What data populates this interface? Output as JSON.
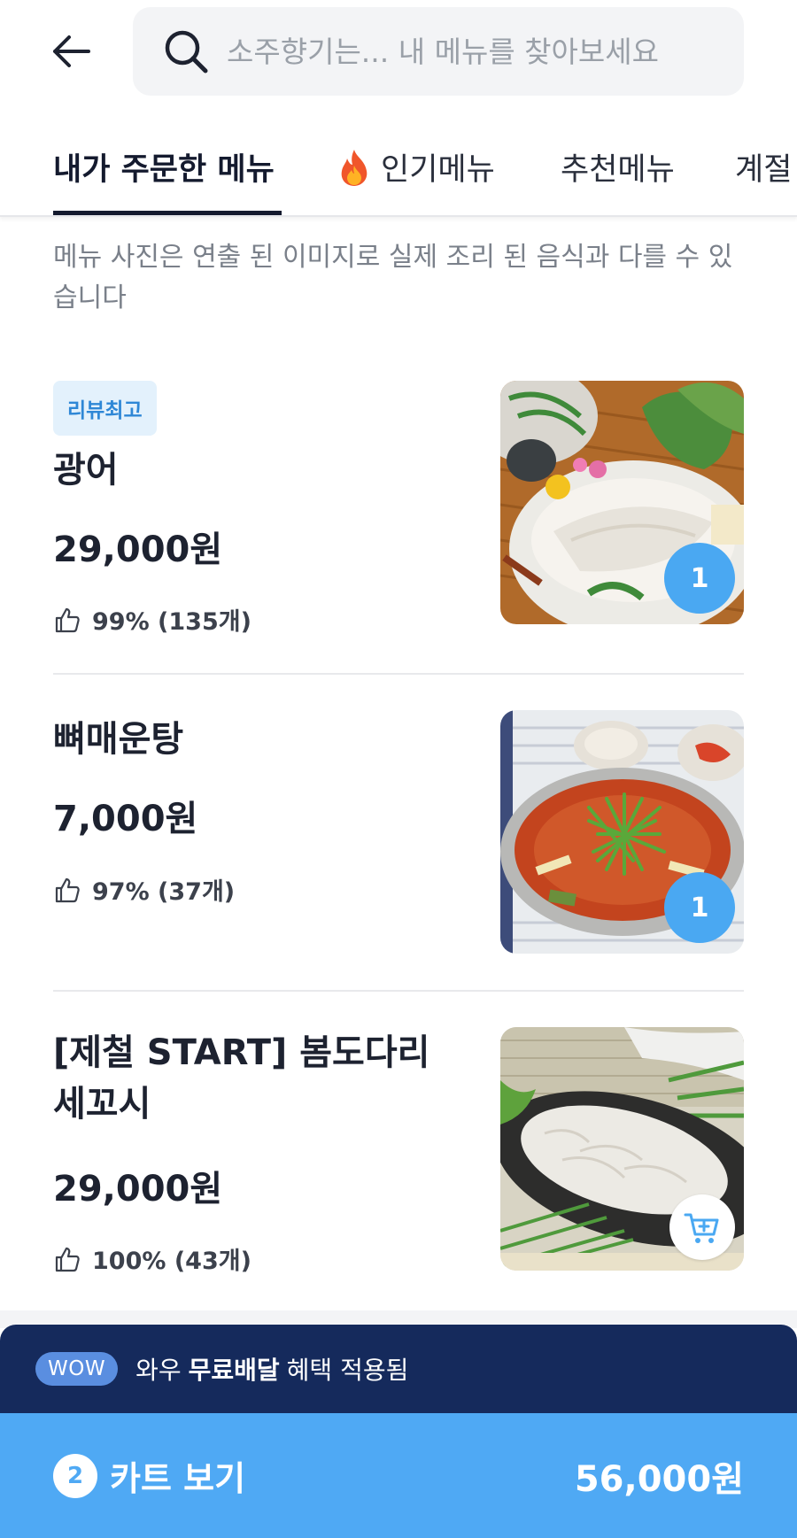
{
  "search": {
    "placeholder": "소주향기는... 내 메뉴를 찾아보세요"
  },
  "tabs": [
    {
      "label": "내가 주문한 메뉴",
      "active": true
    },
    {
      "label": "인기메뉴",
      "icon": "fire-icon"
    },
    {
      "label": "추천메뉴"
    },
    {
      "label": "계절"
    }
  ],
  "notice": "메뉴 사진은 연출 된 이미지로 실제 조리 된 음식과 다를 수 있습니다",
  "menu": [
    {
      "badge": "리뷰최고",
      "name": "광어",
      "price": "29,000원",
      "rating": "99% (135개)",
      "cart_qty": "1"
    },
    {
      "name": "뼈매운탕",
      "price": "7,000원",
      "rating": "97% (37개)",
      "cart_qty": "1"
    },
    {
      "name": "[제철 START] 봄도다리 세꼬시",
      "price": "29,000원",
      "rating": "100% (43개)",
      "action_icon": "cart-add-icon"
    }
  ],
  "wow": {
    "pill": "WOW",
    "text_before": "와우",
    "text_bold": "무료배달",
    "text_after": "혜택 적용됨"
  },
  "cart": {
    "count": "2",
    "label": "카트 보기",
    "total": "56,000원"
  },
  "colors": {
    "accent": "#4fa9f4",
    "navy": "#152a5c",
    "badge_bg": "#e3f1fc",
    "badge_text": "#2e87d6"
  }
}
